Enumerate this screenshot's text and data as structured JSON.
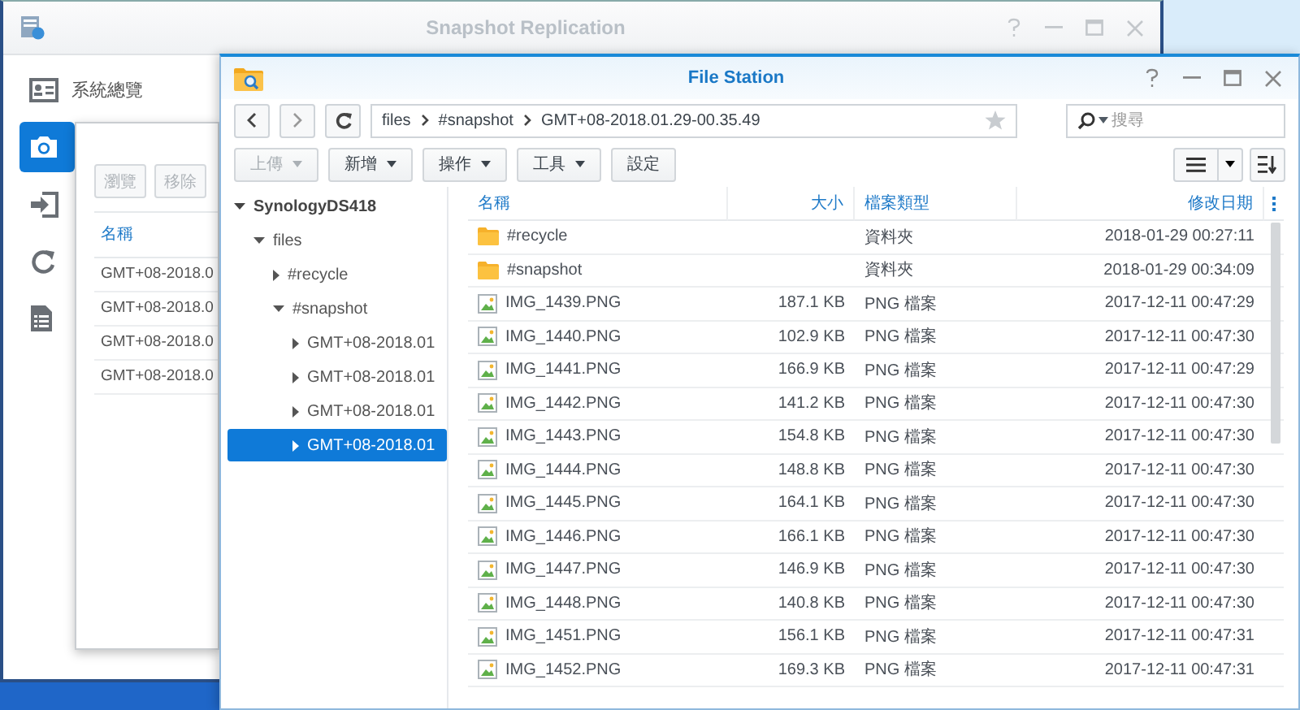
{
  "background_window": {
    "title": "Snapshot Replication",
    "sidebar": [
      {
        "label": "系統總覽",
        "selected": false
      },
      {
        "selected": true
      },
      {
        "selected": false
      },
      {
        "selected": false
      },
      {
        "selected": false
      }
    ],
    "dialog": {
      "buttons": [
        {
          "label": "瀏覽",
          "disabled": true
        },
        {
          "label": "移除",
          "disabled": true
        }
      ],
      "column": "名稱",
      "rows": [
        "GMT+08-2018.0",
        "GMT+08-2018.0",
        "GMT+08-2018.0",
        "GMT+08-2018.0"
      ]
    }
  },
  "window": {
    "title": "File Station"
  },
  "path": [
    "files",
    "#snapshot",
    "GMT+08-2018.01.29-00.35.49"
  ],
  "search": {
    "placeholder": "搜尋"
  },
  "actions": [
    {
      "label": "上傳",
      "disabled": true,
      "dropdown": true
    },
    {
      "label": "新增",
      "disabled": false,
      "dropdown": true
    },
    {
      "label": "操作",
      "disabled": false,
      "dropdown": true
    },
    {
      "label": "工具",
      "disabled": false,
      "dropdown": true
    },
    {
      "label": "設定",
      "disabled": false,
      "dropdown": false
    }
  ],
  "tree": [
    {
      "label": "SynologyDS418",
      "expanded": true,
      "selected": false,
      "children": [
        {
          "label": "files",
          "expanded": true,
          "selected": false,
          "children": [
            {
              "label": "#recycle",
              "expanded": false,
              "selected": false
            },
            {
              "label": "#snapshot",
              "expanded": true,
              "selected": false,
              "children": [
                {
                  "label": "GMT+08-2018.01",
                  "expanded": false,
                  "selected": false
                },
                {
                  "label": "GMT+08-2018.01",
                  "expanded": false,
                  "selected": false
                },
                {
                  "label": "GMT+08-2018.01",
                  "expanded": false,
                  "selected": false
                },
                {
                  "label": "GMT+08-2018.01",
                  "expanded": false,
                  "selected": true
                }
              ]
            }
          ]
        }
      ]
    }
  ],
  "table": {
    "columns": [
      "名稱",
      "大小",
      "檔案類型",
      "修改日期"
    ],
    "rows": [
      {
        "kind": "folder",
        "name": "#recycle",
        "type": "資料夾",
        "modified": "2018-01-29 00:27:11"
      },
      {
        "kind": "folder",
        "name": "#snapshot",
        "type": "資料夾",
        "modified": "2018-01-29 00:34:09"
      },
      {
        "kind": "image",
        "name": "IMG_1439.PNG",
        "size": "187.1 KB",
        "type": "PNG 檔案",
        "modified": "2017-12-11 00:47:29"
      },
      {
        "kind": "image",
        "name": "IMG_1440.PNG",
        "size": "102.9 KB",
        "type": "PNG 檔案",
        "modified": "2017-12-11 00:47:30"
      },
      {
        "kind": "image",
        "name": "IMG_1441.PNG",
        "size": "166.9 KB",
        "type": "PNG 檔案",
        "modified": "2017-12-11 00:47:29"
      },
      {
        "kind": "image",
        "name": "IMG_1442.PNG",
        "size": "141.2 KB",
        "type": "PNG 檔案",
        "modified": "2017-12-11 00:47:30"
      },
      {
        "kind": "image",
        "name": "IMG_1443.PNG",
        "size": "154.8 KB",
        "type": "PNG 檔案",
        "modified": "2017-12-11 00:47:30"
      },
      {
        "kind": "image",
        "name": "IMG_1444.PNG",
        "size": "148.8 KB",
        "type": "PNG 檔案",
        "modified": "2017-12-11 00:47:30"
      },
      {
        "kind": "image",
        "name": "IMG_1445.PNG",
        "size": "164.1 KB",
        "type": "PNG 檔案",
        "modified": "2017-12-11 00:47:30"
      },
      {
        "kind": "image",
        "name": "IMG_1446.PNG",
        "size": "166.1 KB",
        "type": "PNG 檔案",
        "modified": "2017-12-11 00:47:30"
      },
      {
        "kind": "image",
        "name": "IMG_1447.PNG",
        "size": "146.9 KB",
        "type": "PNG 檔案",
        "modified": "2017-12-11 00:47:30"
      },
      {
        "kind": "image",
        "name": "IMG_1448.PNG",
        "size": "140.8 KB",
        "type": "PNG 檔案",
        "modified": "2017-12-11 00:47:30"
      },
      {
        "kind": "image",
        "name": "IMG_1451.PNG",
        "size": "156.1 KB",
        "type": "PNG 檔案",
        "modified": "2017-12-11 00:47:31"
      },
      {
        "kind": "image",
        "name": "IMG_1452.PNG",
        "size": "169.3 KB",
        "type": "PNG 檔案",
        "modified": "2017-12-11 00:47:31"
      }
    ]
  }
}
